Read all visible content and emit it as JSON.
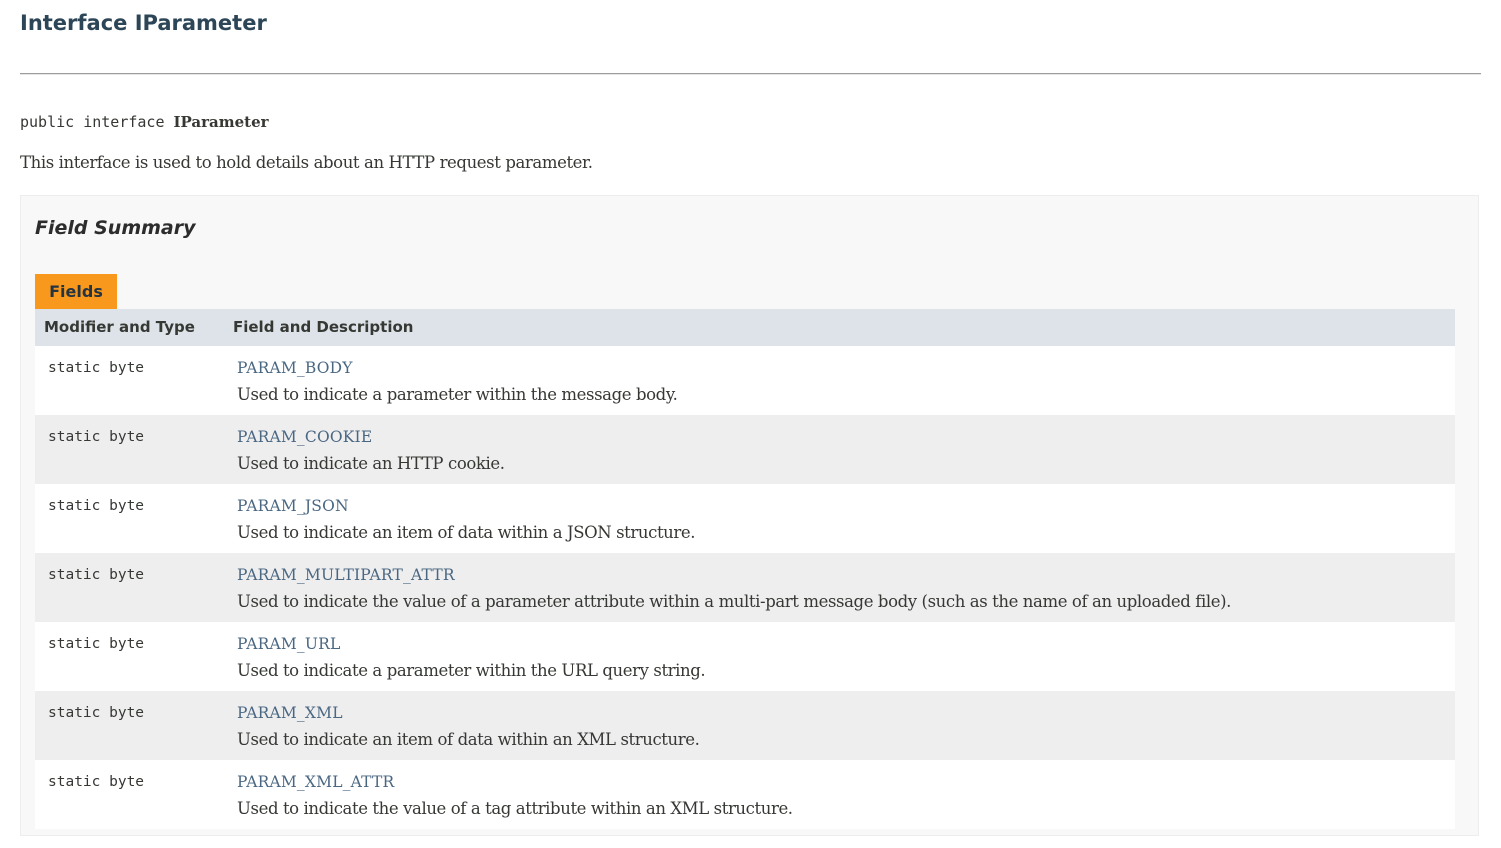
{
  "page": {
    "title": "Interface IParameter",
    "signature_prefix": "public interface ",
    "signature_name": "IParameter",
    "description": "This interface is used to hold details about an HTTP request parameter."
  },
  "field_summary": {
    "heading": "Field Summary",
    "caption": "Fields",
    "columns": {
      "modifier": "Modifier and Type",
      "field": "Field and Description"
    },
    "rows": [
      {
        "modifier": "static byte",
        "name": "PARAM_BODY",
        "description": "Used to indicate a parameter within the message body."
      },
      {
        "modifier": "static byte",
        "name": "PARAM_COOKIE",
        "description": "Used to indicate an HTTP cookie."
      },
      {
        "modifier": "static byte",
        "name": "PARAM_JSON",
        "description": "Used to indicate an item of data within a JSON structure."
      },
      {
        "modifier": "static byte",
        "name": "PARAM_MULTIPART_ATTR",
        "description": "Used to indicate the value of a parameter attribute within a multi-part message body (such as the name of an uploaded file)."
      },
      {
        "modifier": "static byte",
        "name": "PARAM_URL",
        "description": "Used to indicate a parameter within the URL query string."
      },
      {
        "modifier": "static byte",
        "name": "PARAM_XML",
        "description": "Used to indicate an item of data within an XML structure."
      },
      {
        "modifier": "static byte",
        "name": "PARAM_XML_ATTR",
        "description": "Used to indicate the value of a tag attribute within an XML structure."
      }
    ]
  },
  "colors": {
    "title": "#2c4557",
    "link": "#4a6782",
    "caption_tab": "#f8981d",
    "table_header": "#dee3e9",
    "row_alt": "#eeeeef"
  }
}
